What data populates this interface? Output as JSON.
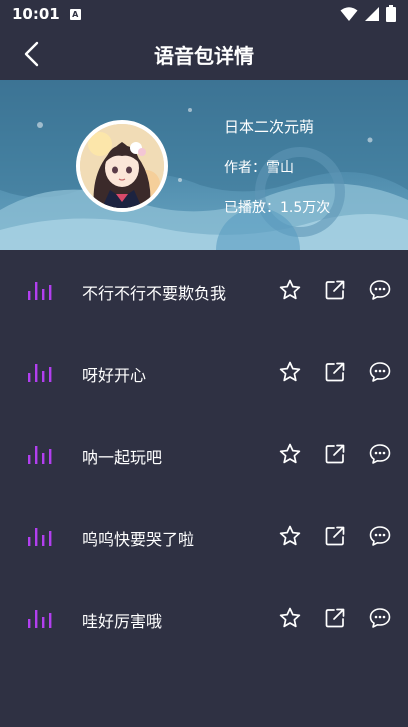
{
  "status": {
    "time": "10:01",
    "sim_label": "A"
  },
  "header": {
    "title": "语音包详情"
  },
  "profile": {
    "name": "日本二次元萌",
    "author_label": "作者：",
    "author": "雪山",
    "plays_label": "已播放：",
    "plays": "1.5万次"
  },
  "colors": {
    "background": "#2f3143",
    "accent": "#b23ff0",
    "icon": "#ffffff"
  },
  "voices": [
    {
      "label": "不行不行不要欺负我"
    },
    {
      "label": "呀好开心"
    },
    {
      "label": "呐一起玩吧"
    },
    {
      "label": "呜呜快要哭了啦"
    },
    {
      "label": "哇好厉害哦"
    }
  ],
  "icons": {
    "wave": "audio-wave-icon",
    "star": "star-icon",
    "share": "share-icon",
    "comment": "comment-icon"
  }
}
